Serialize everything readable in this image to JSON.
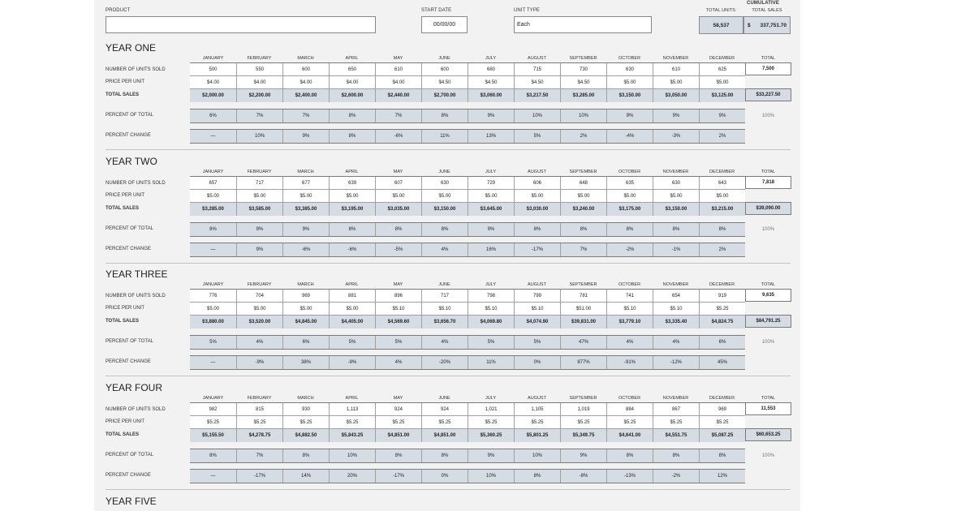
{
  "header": {
    "product_label": "PRODUCT",
    "product_value": "",
    "start_date_label": "START DATE",
    "start_date_value": "00/00/00",
    "unit_type_label": "UNIT TYPE",
    "unit_type_value": "Each",
    "cumulative_label": "CUMULATIVE",
    "total_units_label": "TOTAL UNITS",
    "total_sales_label": "TOTAL SALES",
    "total_units_value": "58,537",
    "total_sales_currency": "$",
    "total_sales_value": "337,751.70"
  },
  "months": [
    "JANUARY",
    "FEBRUARY",
    "MARCH",
    "APRIL",
    "MAY",
    "JUNE",
    "JULY",
    "AUGUST",
    "SEPTEMBER",
    "OCTOBER",
    "NOVEMBER",
    "DECEMBER"
  ],
  "total_header": "TOTAL",
  "row_labels": {
    "units": "NUMBER OF UNITS SOLD",
    "price": "PRICE PER UNIT",
    "sales": "TOTAL SALES",
    "pct_total": "PERCENT OF TOTAL",
    "pct_change": "PERCENT CHANGE"
  },
  "years": [
    {
      "title": "YEAR ONE",
      "units": [
        "500",
        "550",
        "600",
        "650",
        "610",
        "600",
        "680",
        "715",
        "730",
        "630",
        "610",
        "625"
      ],
      "price": [
        "$4.00",
        "$4.00",
        "$4.00",
        "$4.00",
        "$4.00",
        "$4.50",
        "$4.50",
        "$4.50",
        "$4.50",
        "$5.00",
        "$5.00",
        "$5.00"
      ],
      "sales": [
        "$2,000.00",
        "$2,200.00",
        "$2,400.00",
        "$2,600.00",
        "$2,440.00",
        "$2,700.00",
        "$3,060.00",
        "$3,217.50",
        "$3,285.00",
        "$3,150.00",
        "$3,050.00",
        "$3,125.00"
      ],
      "pct_total": [
        "6%",
        "7%",
        "7%",
        "8%",
        "7%",
        "8%",
        "9%",
        "10%",
        "10%",
        "9%",
        "9%",
        "9%"
      ],
      "pct_change": [
        "—",
        "10%",
        "9%",
        "8%",
        "-6%",
        "11%",
        "13%",
        "5%",
        "2%",
        "-4%",
        "-3%",
        "2%"
      ],
      "total_units": "7,500",
      "total_sales": "$33,227.50",
      "total_pct": "100%"
    },
    {
      "title": "YEAR TWO",
      "units": [
        "657",
        "717",
        "677",
        "639",
        "607",
        "630",
        "729",
        "606",
        "648",
        "635",
        "630",
        "643"
      ],
      "price": [
        "$5.00",
        "$5.00",
        "$5.00",
        "$5.00",
        "$5.00",
        "$5.00",
        "$5.00",
        "$5.00",
        "$5.00",
        "$5.00",
        "$5.00",
        "$5.00"
      ],
      "sales": [
        "$3,285.00",
        "$3,585.00",
        "$3,385.00",
        "$3,195.00",
        "$3,035.00",
        "$3,150.00",
        "$3,645.00",
        "$3,030.00",
        "$3,240.00",
        "$3,175.00",
        "$3,150.00",
        "$3,215.00"
      ],
      "pct_total": [
        "8%",
        "9%",
        "9%",
        "8%",
        "8%",
        "8%",
        "9%",
        "8%",
        "8%",
        "8%",
        "8%",
        "8%"
      ],
      "pct_change": [
        "—",
        "9%",
        "-6%",
        "-6%",
        "-5%",
        "4%",
        "16%",
        "-17%",
        "7%",
        "-2%",
        "-1%",
        "2%"
      ],
      "total_units": "7,818",
      "total_sales": "$39,090.00",
      "total_pct": "100%"
    },
    {
      "title": "YEAR THREE",
      "units": [
        "776",
        "704",
        "969",
        "881",
        "896",
        "717",
        "798",
        "799",
        "781",
        "741",
        "654",
        "919"
      ],
      "price": [
        "$5.00",
        "$5.00",
        "$5.00",
        "$5.00",
        "$5.10",
        "$5.10",
        "$5.10",
        "$5.10",
        "$51.00",
        "$5.10",
        "$5.10",
        "$5.25"
      ],
      "sales": [
        "$3,880.00",
        "$3,520.00",
        "$4,845.00",
        "$4,405.00",
        "$4,569.60",
        "$3,656.70",
        "$4,069.80",
        "$4,074.90",
        "$39,831.00",
        "$3,779.10",
        "$3,335.40",
        "$4,824.75"
      ],
      "pct_total": [
        "5%",
        "4%",
        "6%",
        "5%",
        "5%",
        "4%",
        "5%",
        "5%",
        "47%",
        "4%",
        "4%",
        "6%"
      ],
      "pct_change": [
        "—",
        "-9%",
        "38%",
        "-9%",
        "4%",
        "-20%",
        "11%",
        "0%",
        "877%",
        "-91%",
        "-12%",
        "45%"
      ],
      "total_units": "9,635",
      "total_sales": "$84,791.25",
      "total_pct": "100%"
    },
    {
      "title": "YEAR FOUR",
      "units": [
        "982",
        "815",
        "930",
        "1,113",
        "924",
        "924",
        "1,021",
        "1,105",
        "1,019",
        "884",
        "867",
        "969"
      ],
      "price": [
        "$5.25",
        "$5.25",
        "$5.25",
        "$5.25",
        "$5.25",
        "$5.25",
        "$5.25",
        "$5.25",
        "$5.25",
        "$5.25",
        "$5.25",
        "$5.25"
      ],
      "sales": [
        "$5,155.50",
        "$4,278.75",
        "$4,882.50",
        "$5,843.25",
        "$4,851.00",
        "$4,851.00",
        "$5,360.25",
        "$5,801.25",
        "$5,349.75",
        "$4,641.00",
        "$4,551.75",
        "$5,087.25"
      ],
      "pct_total": [
        "8%",
        "7%",
        "8%",
        "10%",
        "8%",
        "8%",
        "9%",
        "10%",
        "9%",
        "8%",
        "8%",
        "8%"
      ],
      "pct_change": [
        "—",
        "-17%",
        "14%",
        "20%",
        "-17%",
        "0%",
        "10%",
        "8%",
        "-8%",
        "-13%",
        "-2%",
        "12%"
      ],
      "total_units": "11,553",
      "total_sales": "$60,653.25",
      "total_pct": "100%"
    },
    {
      "title": "YEAR FIVE"
    }
  ]
}
